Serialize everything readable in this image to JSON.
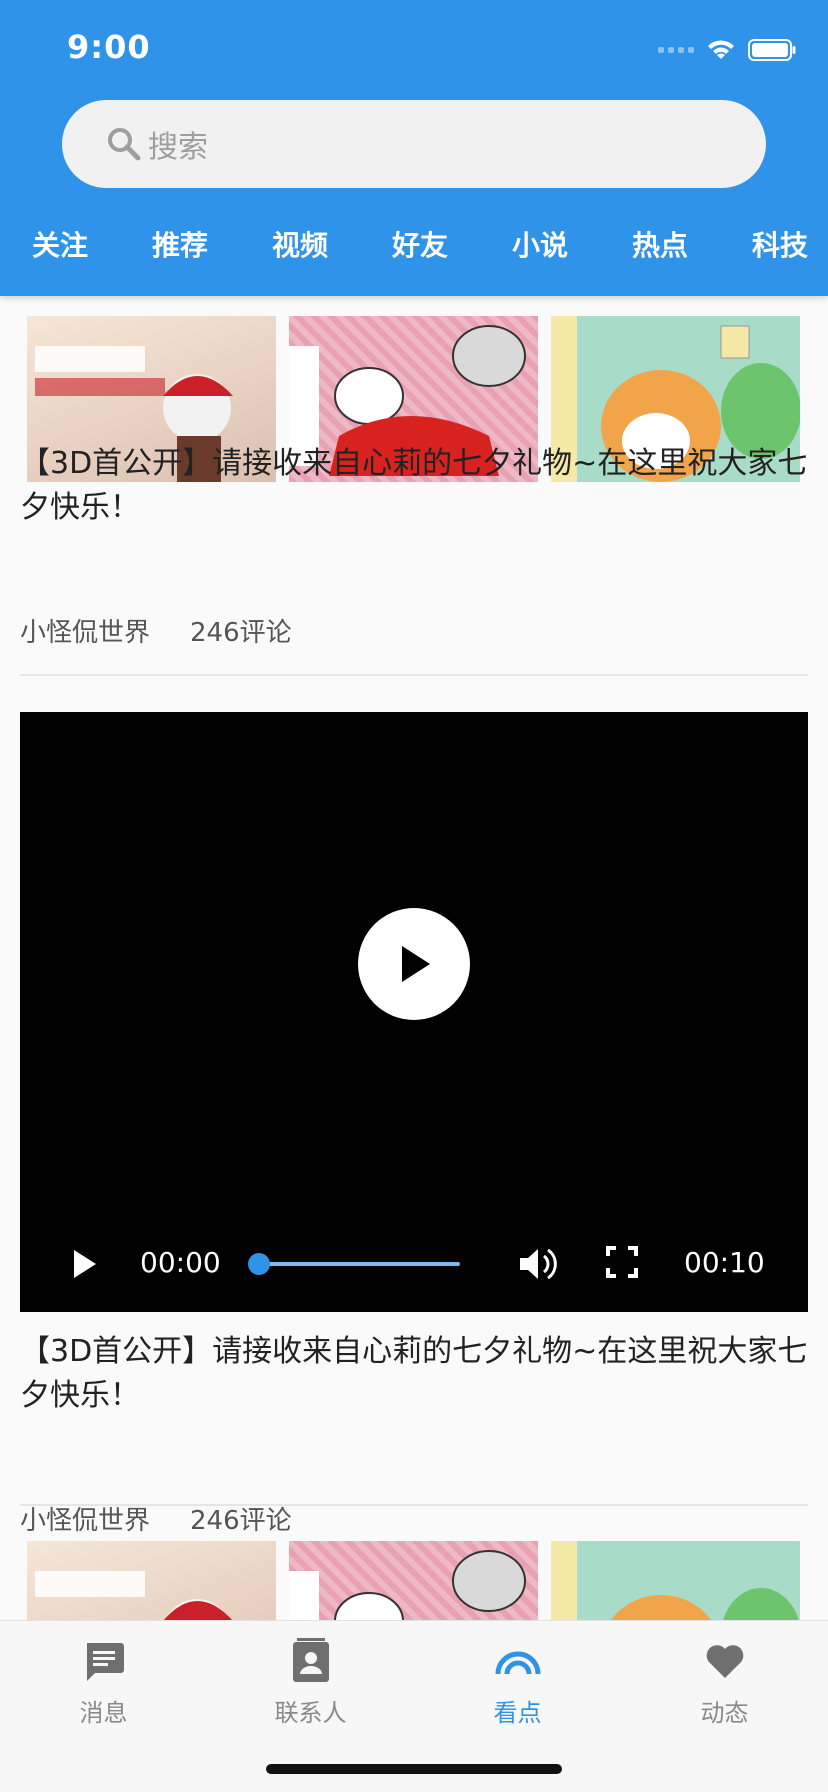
{
  "status": {
    "time": "9:00"
  },
  "search": {
    "placeholder": "搜索"
  },
  "tabs": [
    "关注",
    "推荐",
    "视频",
    "好友",
    "小说",
    "热点",
    "科技"
  ],
  "posts": [
    {
      "title": "【3D首公开】请接收来自心莉的七夕礼物~在这里祝大家七夕快乐！",
      "author": "小怪侃世界",
      "comments": "246评论"
    },
    {
      "title": "【3D首公开】请接收来自心莉的七夕礼物~在这里祝大家七夕快乐！",
      "author": "小怪侃世界",
      "comments": "246评论"
    }
  ],
  "video": {
    "current_time": "00:00",
    "duration": "00:10",
    "progress": 0
  },
  "bottom_nav": [
    {
      "label": "消息",
      "icon": "message-icon"
    },
    {
      "label": "联系人",
      "icon": "contacts-icon"
    },
    {
      "label": "看点",
      "icon": "rainbow-icon",
      "active": true
    },
    {
      "label": "动态",
      "icon": "heart-icon"
    }
  ],
  "colors": {
    "primary": "#2f93ea",
    "nav_inactive": "#8a8a8a"
  }
}
